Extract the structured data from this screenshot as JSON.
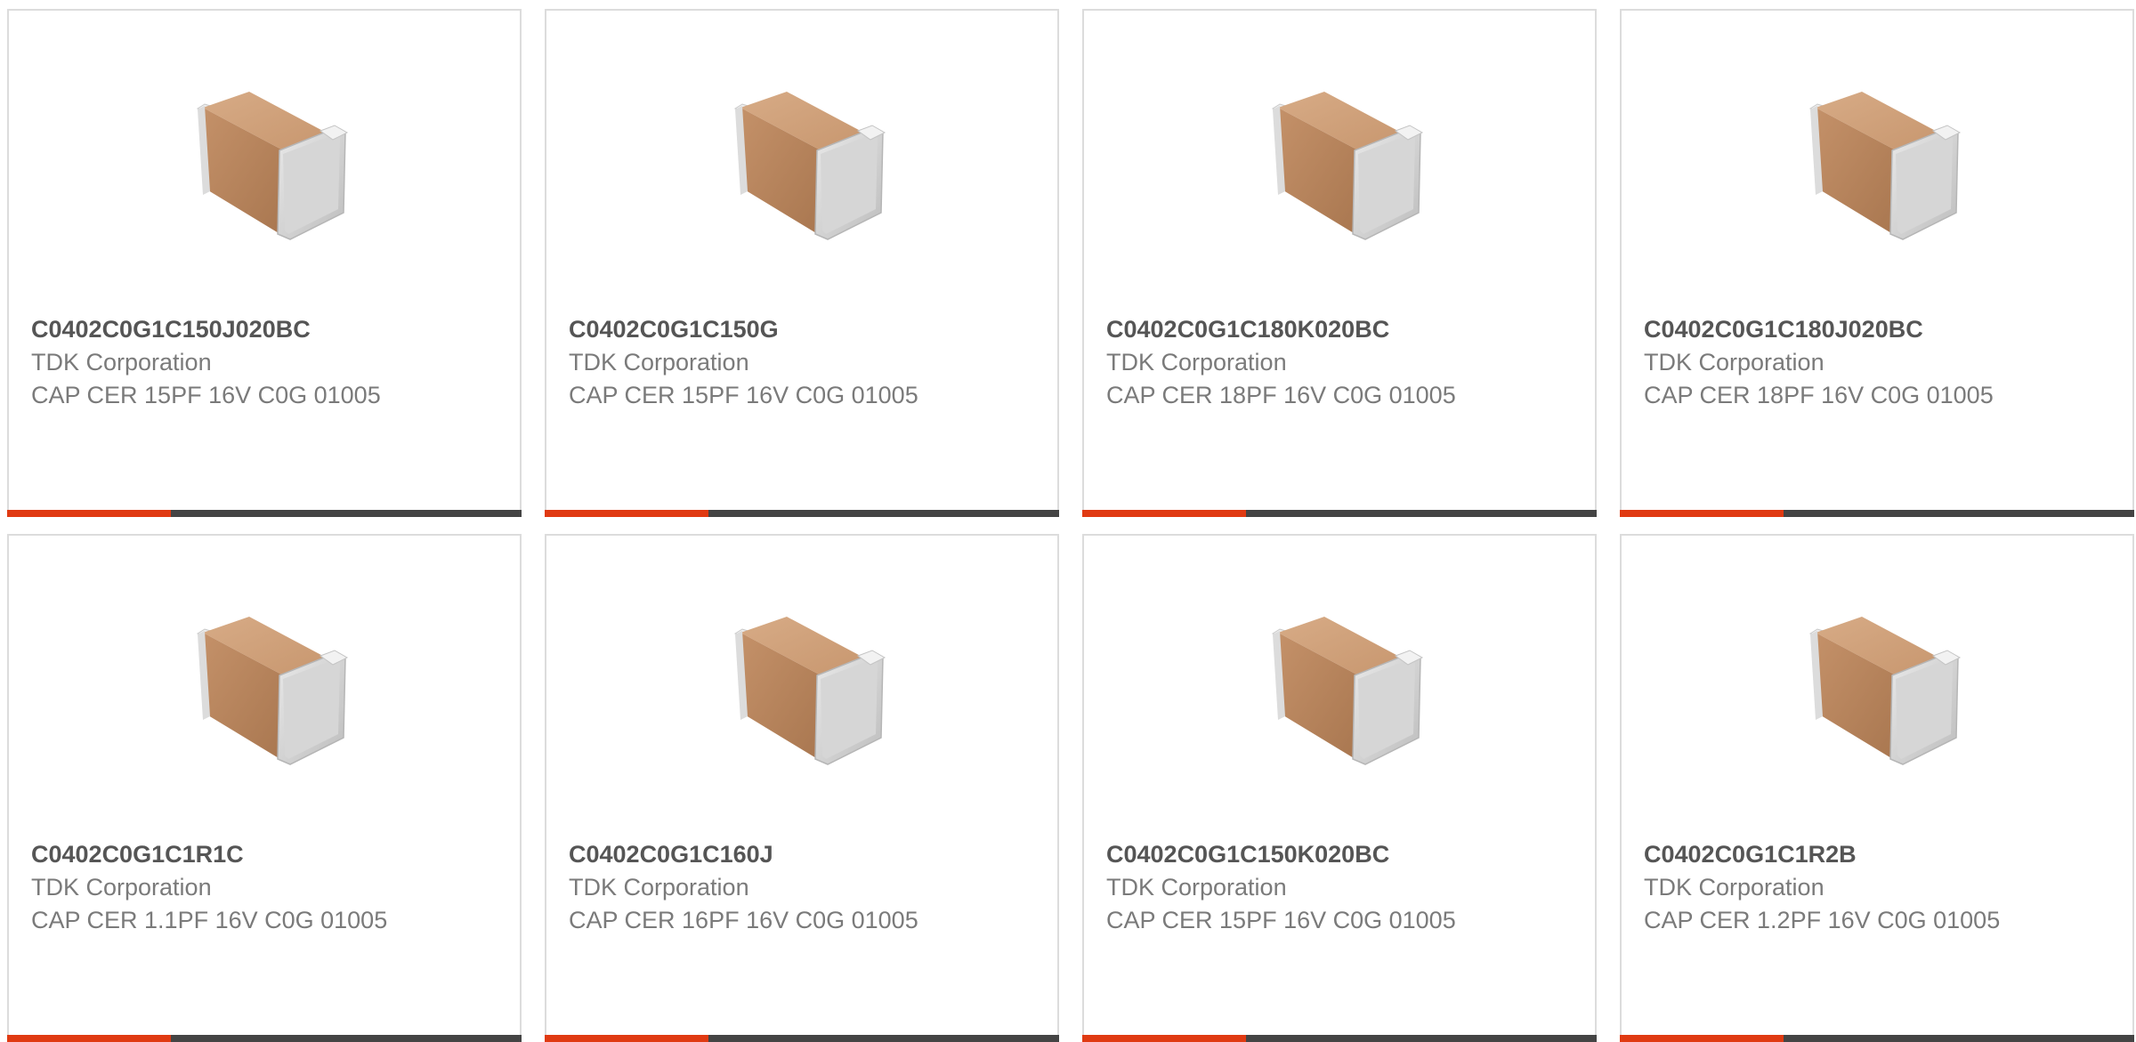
{
  "colors": {
    "accent": "#e03a12",
    "bar": "#444444",
    "border": "#dcdcdc",
    "title": "#555555",
    "text": "#7a7a7a"
  },
  "products": [
    {
      "part": "C0402C0G1C150J020BC",
      "manufacturer": "TDK Corporation",
      "description": "CAP CER 15PF 16V C0G 01005",
      "icon": "capacitor-chip-image"
    },
    {
      "part": "C0402C0G1C150G",
      "manufacturer": "TDK Corporation",
      "description": "CAP CER 15PF 16V C0G 01005",
      "icon": "capacitor-chip-image"
    },
    {
      "part": "C0402C0G1C180K020BC",
      "manufacturer": "TDK Corporation",
      "description": "CAP CER 18PF 16V C0G 01005",
      "icon": "capacitor-chip-image"
    },
    {
      "part": "C0402C0G1C180J020BC",
      "manufacturer": "TDK Corporation",
      "description": "CAP CER 18PF 16V C0G 01005",
      "icon": "capacitor-chip-image"
    },
    {
      "part": "C0402C0G1C1R1C",
      "manufacturer": "TDK Corporation",
      "description": "CAP CER 1.1PF 16V C0G 01005",
      "icon": "capacitor-chip-image"
    },
    {
      "part": "C0402C0G1C160J",
      "manufacturer": "TDK Corporation",
      "description": "CAP CER 16PF 16V C0G 01005",
      "icon": "capacitor-chip-image"
    },
    {
      "part": "C0402C0G1C150K020BC",
      "manufacturer": "TDK Corporation",
      "description": "CAP CER 15PF 16V C0G 01005",
      "icon": "capacitor-chip-image"
    },
    {
      "part": "C0402C0G1C1R2B",
      "manufacturer": "TDK Corporation",
      "description": "CAP CER 1.2PF 16V C0G 01005",
      "icon": "capacitor-chip-image"
    }
  ]
}
